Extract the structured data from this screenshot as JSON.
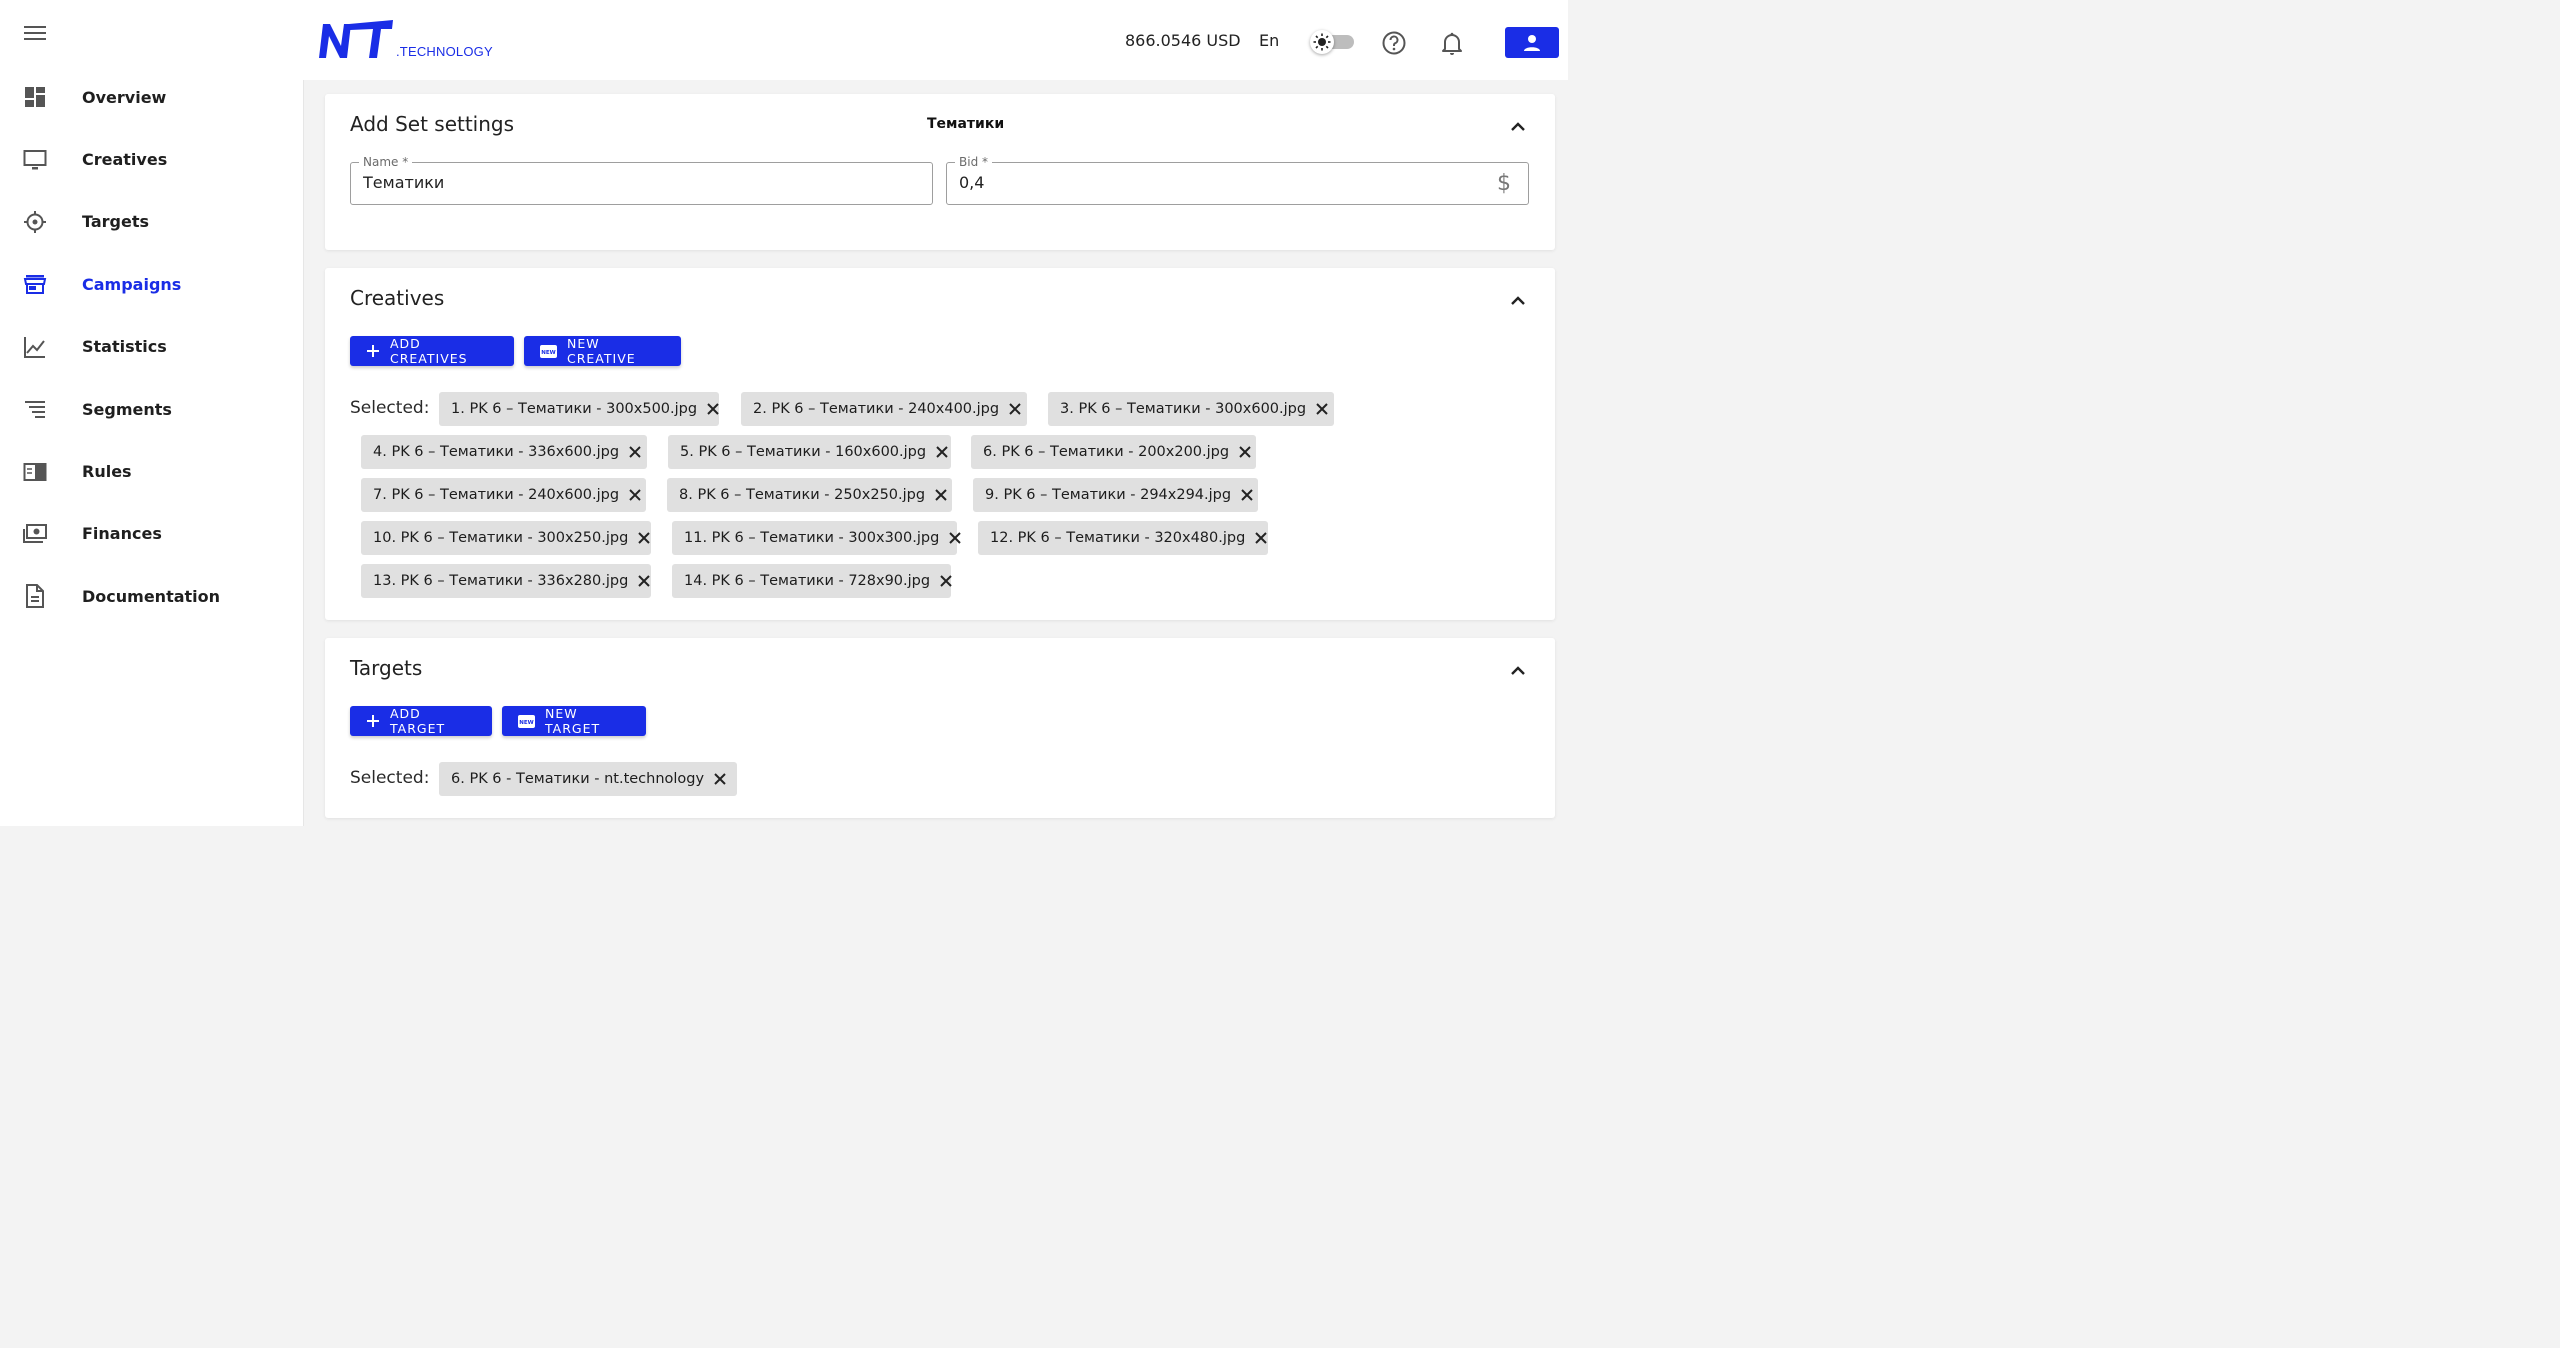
{
  "sidebar": {
    "items": [
      {
        "label": "Overview",
        "icon": "dashboard-icon"
      },
      {
        "label": "Creatives",
        "icon": "monitor-icon"
      },
      {
        "label": "Targets",
        "icon": "crosshair-icon"
      },
      {
        "label": "Campaigns",
        "icon": "storefront-icon",
        "active": true
      },
      {
        "label": "Statistics",
        "icon": "line-chart-icon"
      },
      {
        "label": "Segments",
        "icon": "segments-icon"
      },
      {
        "label": "Rules",
        "icon": "book-icon"
      },
      {
        "label": "Finances",
        "icon": "money-icon"
      },
      {
        "label": "Documentation",
        "icon": "document-icon"
      }
    ]
  },
  "header": {
    "logo_sub": ".TECHNOLOGY",
    "balance": "866.0546 USD",
    "lang": "En"
  },
  "colors": {
    "accent": "#1a2de6",
    "chip": "#e0e0e0",
    "background": "#f3f3f3"
  },
  "settings": {
    "title": "Add Set settings",
    "subject": "Тематики",
    "name_label": "Name *",
    "name_value": "Тематики",
    "bid_label": "Bid *",
    "bid_value": "0,4",
    "bid_currency": "$"
  },
  "creatives": {
    "title": "Creatives",
    "add_label": "ADD CREATIVES",
    "new_label": "NEW CREATIVE",
    "selected_label": "Selected:",
    "chips": [
      "1. PK 6 – Тематики - 300x500.jpg",
      "2. PK 6 – Тематики - 240x400.jpg",
      "3. PK 6 – Тематики - 300x600.jpg",
      "4. PK 6 – Тематики - 336x600.jpg",
      "5. PK 6 – Тематики - 160x600.jpg",
      "6. PK 6 – Тематики - 200x200.jpg",
      "7. PK 6 – Тематики - 240x600.jpg",
      "8. PK 6 – Тематики - 250x250.jpg",
      "9. PK 6 – Тематики - 294x294.jpg",
      "10. PK 6 – Тематики - 300x250.jpg",
      "11. PK 6 – Тематики - 300x300.jpg",
      "12. PK 6 – Тематики - 320x480.jpg",
      "13. PK 6 – Тематики - 336x280.jpg",
      "14. PK 6 – Тематики - 728x90.jpg"
    ]
  },
  "targets": {
    "title": "Targets",
    "add_label": "ADD TARGET",
    "new_label": "NEW TARGET",
    "selected_label": "Selected:",
    "chips": [
      "6. PK 6 - Тематики - nt.technology"
    ]
  }
}
